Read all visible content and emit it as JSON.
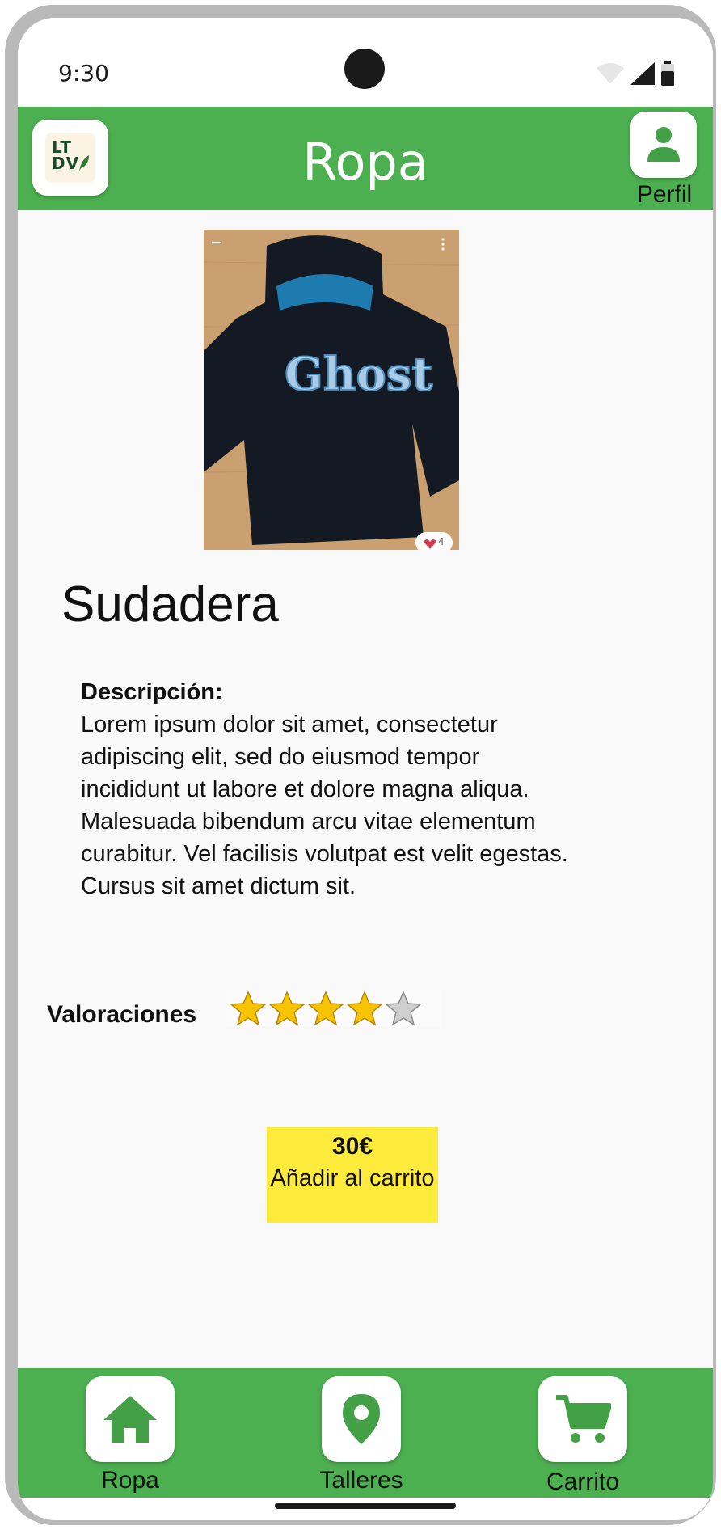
{
  "status_bar": {
    "time": "9:30"
  },
  "header": {
    "title": "Ropa",
    "logo_text_line1": "LT",
    "logo_text_line2": "DV",
    "profile_label": "Perfil"
  },
  "product": {
    "name": "Sudadera",
    "image_like_count": "4",
    "description_heading": "Descripción:",
    "description": "Lorem ipsum dolor sit amet, consectetur adipiscing elit, sed do eiusmod tempor incididunt ut labore et dolore magna aliqua. Malesuada bibendum arcu vitae elementum curabitur. Vel facilisis volutpat est velit egestas. Cursus sit amet dictum sit.",
    "ratings_label": "Valoraciones",
    "rating": 4,
    "rating_max": 5,
    "price": "30€",
    "add_to_cart_label": "Añadir al carrito"
  },
  "bottom_nav": {
    "items": [
      {
        "label": "Ropa",
        "icon": "home-icon"
      },
      {
        "label": "Talleres",
        "icon": "location-pin-icon"
      },
      {
        "label": "Carrito",
        "icon": "cart-icon"
      }
    ]
  },
  "colors": {
    "accent_green": "#4caf50",
    "button_yellow": "#ffeb3b",
    "star_gold": "#f6c400",
    "star_grey": "#cfcfcf"
  }
}
